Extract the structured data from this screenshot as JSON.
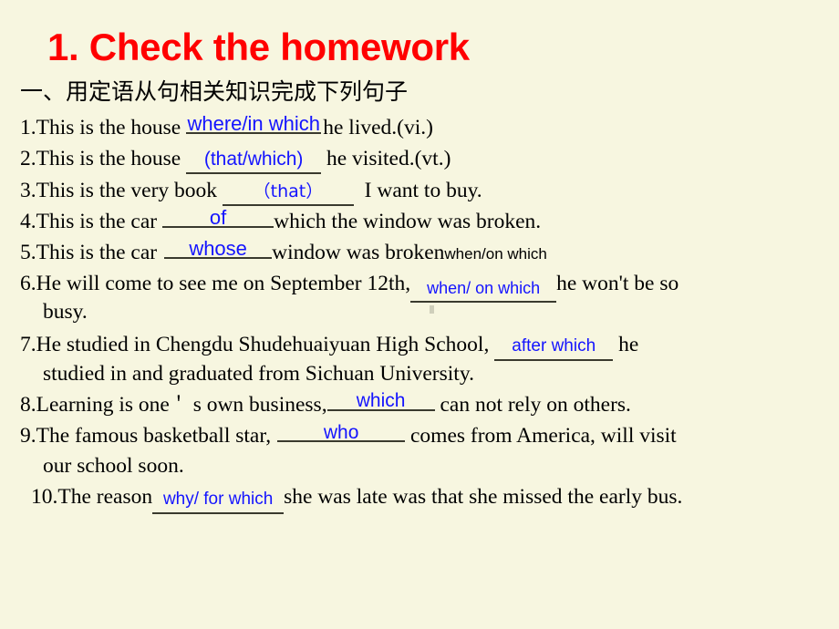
{
  "slide": {
    "background_color": "#F7F6E0",
    "title": "1. Check the homework",
    "title_color": "#FF0000",
    "answer_color": "#1414FF",
    "rule_color": "#3A3A2E",
    "instruction_cn": "一、用定语从句相关知识完成下列句子"
  },
  "exercises": [
    {
      "number": "1.",
      "before": "This is the house",
      "answer": "where/in which",
      "answer_style": "above-rule",
      "after": "he lived.(vi.)",
      "tail": ""
    },
    {
      "number": "2.",
      "before": "This is the house",
      "answer": "(that/which)",
      "answer_style": "on-rule",
      "after": "he visited.(vt.)",
      "tail": ""
    },
    {
      "number": "3.",
      "before": "This is the very book",
      "answer": "（that）",
      "answer_style": "on-rule",
      "after": "I want to buy.",
      "tail": ""
    },
    {
      "number": "4.",
      "before": "This is the car",
      "answer": "of",
      "answer_style": "above-rule",
      "after": "which the window was broken.",
      "tail": ""
    },
    {
      "number": "5.",
      "before": "This is the car",
      "answer": "whose",
      "answer_style": "above-rule",
      "after": "window was broken",
      "tail": "when/on which"
    },
    {
      "number": "6.",
      "before": "He will come to see me on September 12th,",
      "answer": "when/ on which",
      "answer_style": "on-rule",
      "after": "he won't be so",
      "wrap": "busy."
    },
    {
      "number": "7.",
      "before": "He studied in Chengdu Shudehuaiyuan High School,",
      "answer": "after which",
      "answer_style": "on-rule",
      "after": "he",
      "wrap": "studied in and graduated from Sichuan University."
    },
    {
      "number": "8.",
      "before_a": "Learning is one",
      "apostrophe": "＇",
      "before_b": "s own business,",
      "answer": "which",
      "answer_style": "above-rule",
      "after": "can not rely on others.",
      "tail": ""
    },
    {
      "number": "9.",
      "before": "The famous basketball star,",
      "answer": "who",
      "answer_style": "above-rule",
      "after": "comes from America, will visit",
      "wrap": "our school soon."
    },
    {
      "number": "10.",
      "before": "The reason",
      "answer": "why/ for which",
      "answer_style": "on-rule",
      "after": "she was late was that she missed the early bus.",
      "tail": ""
    }
  ]
}
